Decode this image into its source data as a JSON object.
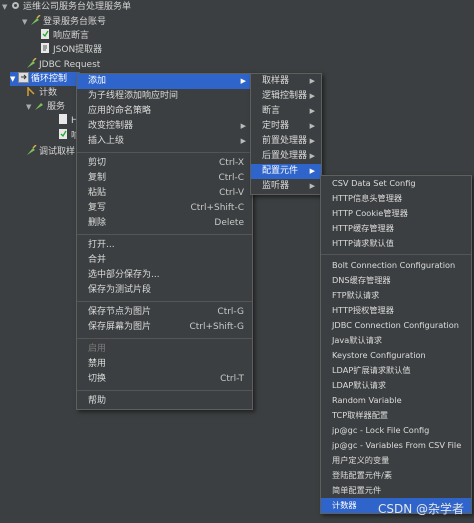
{
  "tree": {
    "root": "运维公司服务台处理服务单",
    "login_account": "登录服务台账号",
    "response_assert": "响应断言",
    "json_extractor": "JSON提取器",
    "jdbc_request": "JDBC Request",
    "loop_controller": "循环控制",
    "counter": "计数",
    "service": "服务",
    "h_node": "H",
    "r_node": "响",
    "debug_sampler": "调试取样"
  },
  "context_menu": {
    "items": [
      {
        "label": "添加",
        "submenu": true,
        "highlighted": true
      },
      {
        "label": "为子线程添加响应时间"
      },
      {
        "label": "应用的命名策略"
      },
      {
        "label": "改变控制器",
        "submenu": true
      },
      {
        "label": "插入上级",
        "submenu": true
      },
      {
        "label": "剪切",
        "shortcut": "Ctrl-X"
      },
      {
        "label": "复制",
        "shortcut": "Ctrl-C"
      },
      {
        "label": "粘贴",
        "shortcut": "Ctrl-V"
      },
      {
        "label": "复写",
        "shortcut": "Ctrl+Shift-C"
      },
      {
        "label": "删除",
        "shortcut": "Delete"
      },
      {
        "label": "打开..."
      },
      {
        "label": "合并"
      },
      {
        "label": "选中部分保存为..."
      },
      {
        "label": "保存为测试片段"
      },
      {
        "label": "保存节点为图片",
        "shortcut": "Ctrl-G"
      },
      {
        "label": "保存屏幕为图片",
        "shortcut": "Ctrl+Shift-G"
      },
      {
        "label": "启用",
        "disabled": true
      },
      {
        "label": "禁用"
      },
      {
        "label": "切换",
        "shortcut": "Ctrl-T"
      },
      {
        "label": "帮助"
      }
    ]
  },
  "add_menu": {
    "items": [
      {
        "label": "取样器"
      },
      {
        "label": "逻辑控制器"
      },
      {
        "label": "断言"
      },
      {
        "label": "定时器"
      },
      {
        "label": "前置处理器"
      },
      {
        "label": "后置处理器"
      },
      {
        "label": "配置元件",
        "highlighted": true
      },
      {
        "label": "监听器"
      }
    ]
  },
  "config_menu": {
    "items": [
      {
        "label": "CSV Data Set Config"
      },
      {
        "label": "HTTP信息头管理器"
      },
      {
        "label": "HTTP Cookie管理器"
      },
      {
        "label": "HTTP缓存管理器"
      },
      {
        "label": "HTTP请求默认值"
      },
      {
        "label": "Bolt Connection Configuration"
      },
      {
        "label": "DNS缓存管理器"
      },
      {
        "label": "FTP默认请求"
      },
      {
        "label": "HTTP授权管理器"
      },
      {
        "label": "JDBC Connection Configuration"
      },
      {
        "label": "Java默认请求"
      },
      {
        "label": "Keystore Configuration"
      },
      {
        "label": "LDAP扩展请求默认值"
      },
      {
        "label": "LDAP默认请求"
      },
      {
        "label": "Random Variable"
      },
      {
        "label": "TCP取样器配置"
      },
      {
        "label": "jp@gc - Lock File Config"
      },
      {
        "label": "jp@gc - Variables From CSV File"
      },
      {
        "label": "用户定义的变量"
      },
      {
        "label": "登陆配置元件/素"
      },
      {
        "label": "简单配置元件"
      },
      {
        "label": "计数器",
        "highlighted": true
      }
    ]
  },
  "watermark": "CSDN @杂学者",
  "colors": {
    "background": "#3c3f41",
    "highlight": "#2f65ca",
    "text": "#dcdcdc"
  }
}
